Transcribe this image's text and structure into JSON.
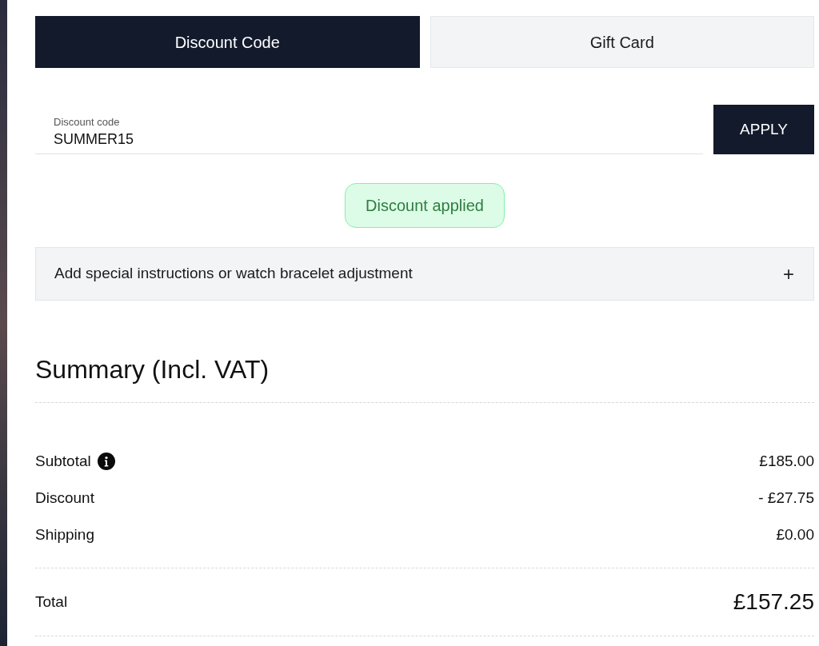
{
  "tabs": [
    {
      "label": "Discount Code",
      "selected": true
    },
    {
      "label": "Gift Card",
      "selected": false
    }
  ],
  "discount_field": {
    "label": "Discount code",
    "value": "SUMMER15"
  },
  "apply_button": {
    "label": "APPLY"
  },
  "status_message": {
    "kind": "success",
    "text": "Discount applied"
  },
  "instructions_accordion": {
    "label": "Add special instructions or watch bracelet adjustment",
    "toggle": "+"
  },
  "summary": {
    "title": "Summary (Incl. VAT)",
    "rows": [
      {
        "label": "Subtotal",
        "value": "£185.00",
        "info_icon": true
      },
      {
        "label": "Discount",
        "value": "- £27.75",
        "info_icon": false
      },
      {
        "label": "Shipping",
        "value": "£0.00",
        "info_icon": false
      }
    ],
    "total": {
      "label": "Total",
      "value": "£157.25"
    }
  }
}
